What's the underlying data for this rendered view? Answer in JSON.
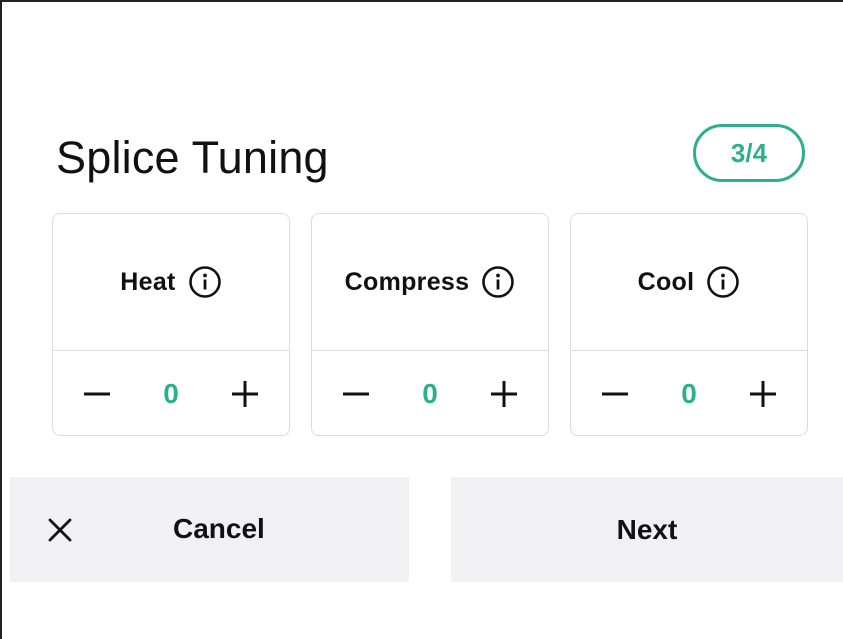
{
  "page": {
    "title": "Splice Tuning",
    "step_indicator": "3/4"
  },
  "cards": [
    {
      "label": "Heat",
      "value": "0",
      "minus": "−",
      "plus": "+",
      "icon": "info-icon"
    },
    {
      "label": "Compress",
      "value": "0",
      "minus": "−",
      "plus": "+",
      "icon": "info-icon"
    },
    {
      "label": "Cool",
      "value": "0",
      "minus": "−",
      "plus": "+",
      "icon": "info-icon"
    }
  ],
  "actions": {
    "cancel_label": "Cancel",
    "cancel_icon": "close-icon",
    "next_label": "Next"
  },
  "colors": {
    "accent": "#2bb08a",
    "button_bg": "#f1f1f4",
    "border": "#dcdcdf",
    "text": "#111111"
  }
}
